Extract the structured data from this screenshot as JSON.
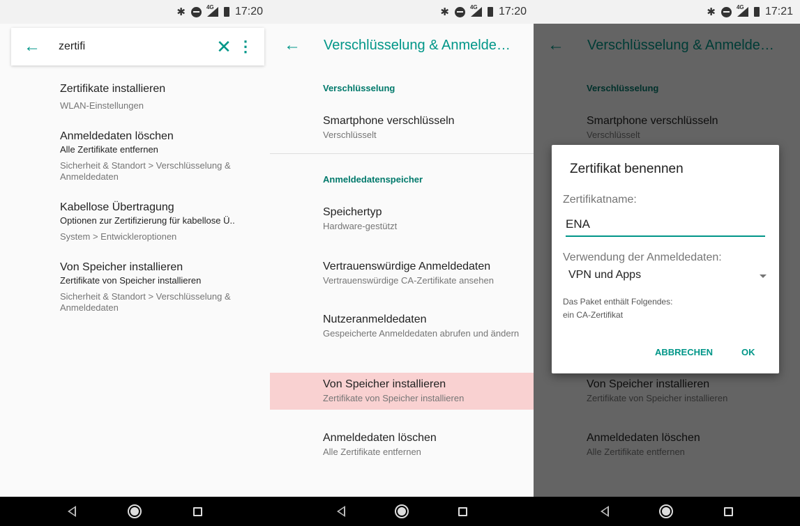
{
  "status": {
    "p1_time": "17:20",
    "p2_time": "17:20",
    "p3_time": "17:21",
    "net": "4G"
  },
  "search": {
    "query": "zertifi",
    "results": [
      {
        "title": "Zertifikate installieren",
        "summary": "",
        "path": "WLAN-Einstellungen"
      },
      {
        "title": "Anmeldedaten löschen",
        "summary": "Alle Zertifikate entfernen",
        "path": "Sicherheit & Standort > Verschlüsselung & Anmeldedaten"
      },
      {
        "title": "Kabellose Übertragung",
        "summary": "Optionen zur Zertifizierung für kabellose Ü..",
        "path": "System > Entwickleroptionen"
      },
      {
        "title": "Von Speicher installieren",
        "summary": "Zertifikate von Speicher installieren",
        "path": "Sicherheit & Standort > Verschlüsselung & Anmeldedaten"
      }
    ]
  },
  "settings": {
    "title": "Verschlüsselung & Anmelde…",
    "section1": "Verschlüsselung",
    "section2": "Anmeldedatenspeicher",
    "items": [
      {
        "title": "Smartphone verschlüsseln",
        "summary": "Verschlüsselt"
      },
      {
        "title": "Speichertyp",
        "summary": "Hardware-gestützt"
      },
      {
        "title": "Vertrauenswürdige Anmeldedaten",
        "summary": "Vertrauenswürdige CA-Zertifikate ansehen"
      },
      {
        "title": "Nutzeranmeldedaten",
        "summary": "Gespeicherte Anmeldedaten abrufen und ändern"
      },
      {
        "title": "Von Speicher installieren",
        "summary": "Zertifikate von Speicher installieren"
      },
      {
        "title": "Anmeldedaten löschen",
        "summary": "Alle Zertifikate entfernen"
      }
    ]
  },
  "dialog": {
    "title": "Zertifikat benennen",
    "name_label": "Zertifikatname:",
    "name_value": "ENA",
    "usage_label": "Verwendung der Anmeldedaten:",
    "usage_value": "VPN und Apps",
    "info_line1": "Das Paket enthält Folgendes:",
    "info_line2": "ein CA-Zertifikat",
    "cancel": "ABBRECHEN",
    "ok": "OK"
  },
  "colors": {
    "accent": "#009688",
    "highlight": "#f9d1d1"
  },
  "icons": [
    "bluetooth-icon",
    "dnd-icon",
    "signal-icon",
    "battery-icon",
    "back-arrow-icon",
    "clear-icon",
    "more-icon",
    "nav-back-icon",
    "nav-home-icon",
    "nav-recent-icon"
  ]
}
